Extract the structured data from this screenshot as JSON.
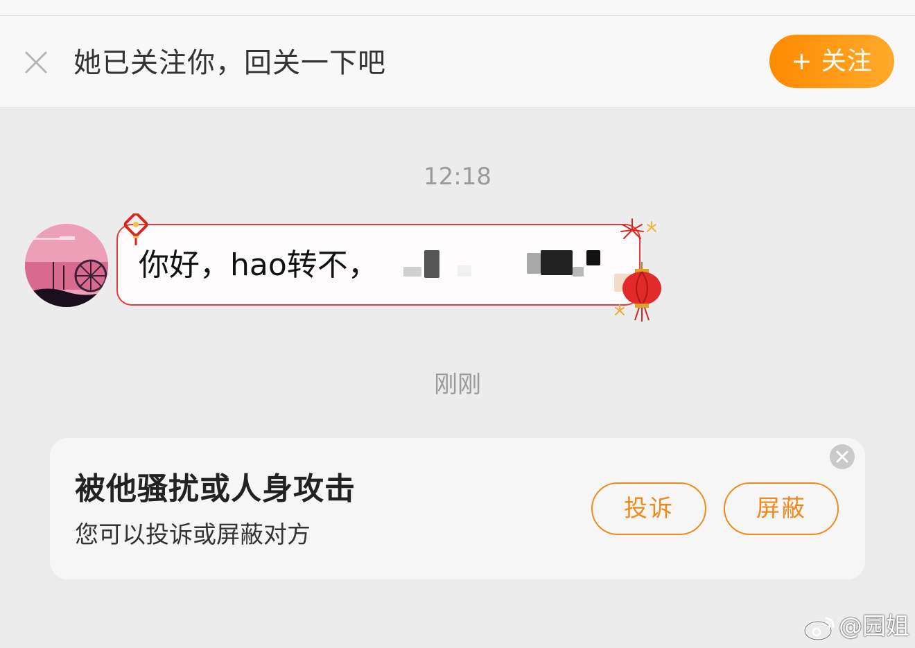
{
  "follow_prompt": {
    "text": "她已关注你，回关一下吧",
    "follow_button_label": "+ 关注",
    "accent_color": "#ff9a0f"
  },
  "conversation": {
    "messages": [
      {
        "timestamp": "12:18",
        "sender": "other",
        "text": "你好，hao转不，",
        "bubble_border_color": "#e83a3a",
        "has_redacted_content": true
      }
    ],
    "recent_label": "刚刚"
  },
  "harassment_card": {
    "title": "被他骚扰或人身攻击",
    "subtitle": "您可以投诉或屏蔽对方",
    "report_button": "投诉",
    "block_button": "屏蔽",
    "button_color": "#f08a1a"
  },
  "watermark": {
    "text": "@园姐"
  }
}
